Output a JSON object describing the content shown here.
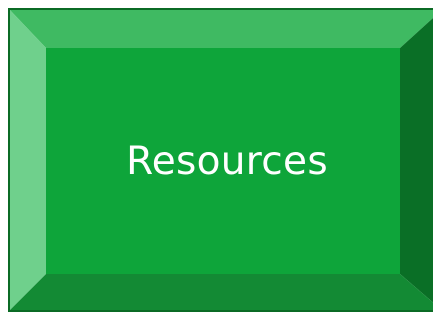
{
  "button": {
    "label": "Resources",
    "colors": {
      "face": "#0ea53a",
      "top_bevel": "#3fba62",
      "left_bevel": "#6fd08c",
      "right_bevel": "#0a6f26",
      "bottom_bevel": "#138a34",
      "border": "#0b6b25",
      "text": "#ffffff"
    }
  }
}
